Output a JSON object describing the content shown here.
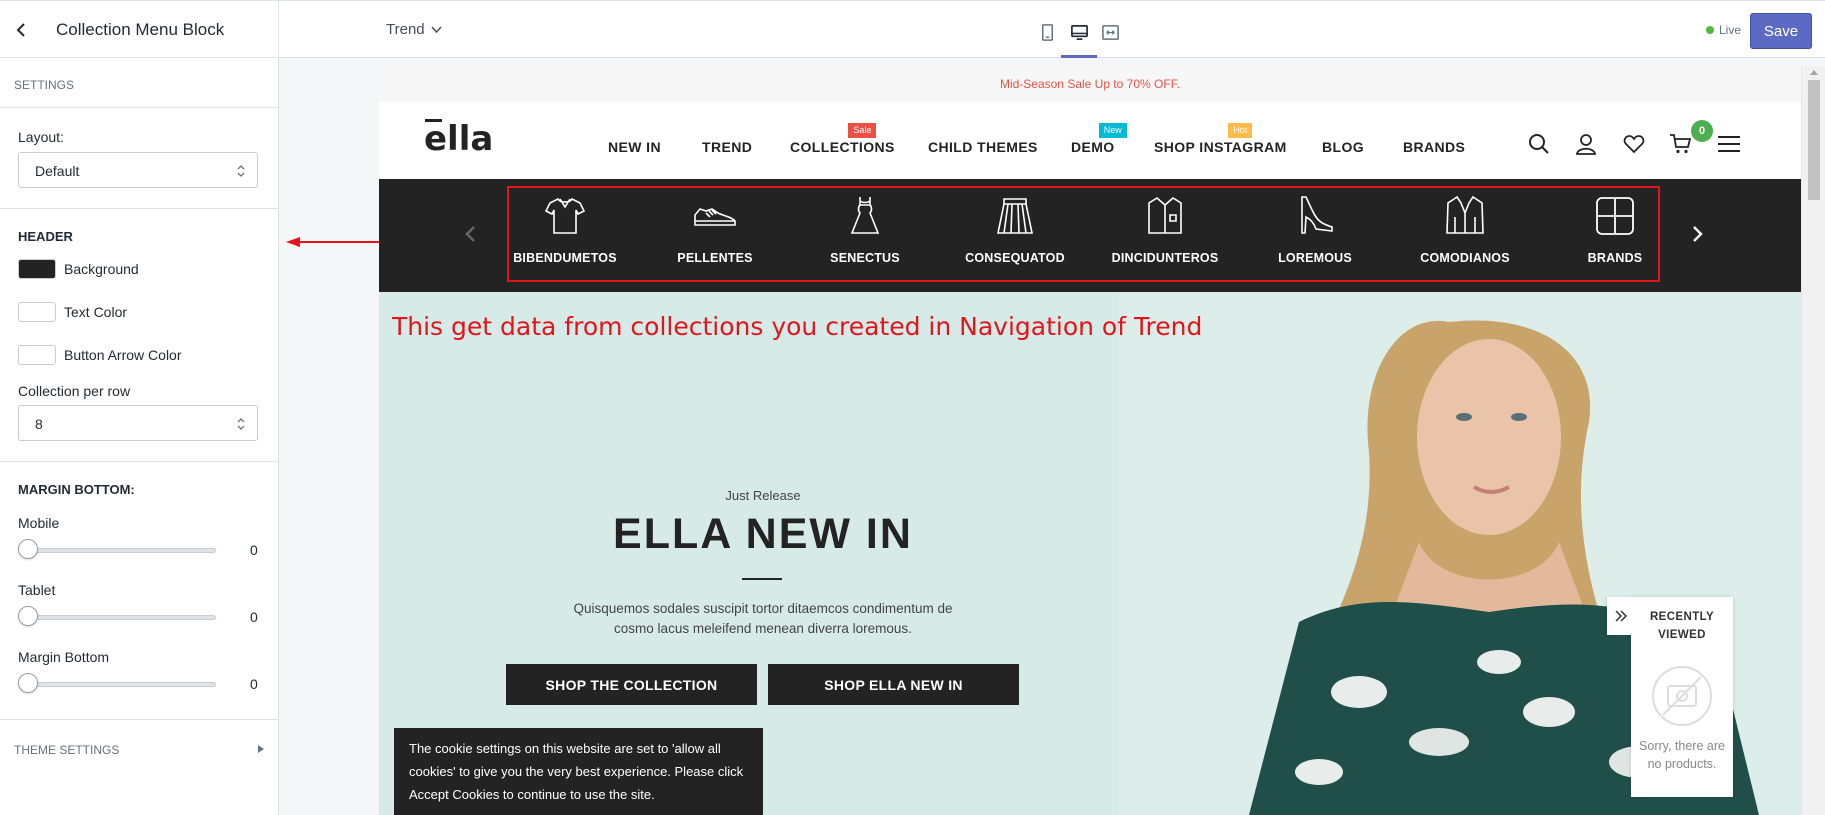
{
  "topbar": {
    "title": "Collection Menu Block",
    "theme_name": "Trend",
    "live_label": "Live",
    "save_label": "Save"
  },
  "sidebar": {
    "settings_heading": "SETTINGS",
    "layout_label": "Layout:",
    "layout_value": "Default",
    "header_heading": "HEADER",
    "background_label": "Background",
    "background_color": "#232323",
    "text_color_label": "Text Color",
    "text_color": "#ffffff",
    "arrow_color_label": "Button Arrow Color",
    "arrow_color": "#ffffff",
    "per_row_label": "Collection per row",
    "per_row_value": "8",
    "margin_heading": "MARGIN BOTTOM:",
    "mobile_label": "Mobile",
    "mobile_value": "0",
    "tablet_label": "Tablet",
    "tablet_value": "0",
    "margin_bottom_label": "Margin Bottom",
    "margin_bottom_value": "0",
    "theme_settings_label": "THEME SETTINGS"
  },
  "preview": {
    "announcement": "Mid-Season Sale Up to 70% OFF.",
    "logo_text": "ella",
    "menu": [
      {
        "label": "NEW IN",
        "badge": "",
        "badge_color": ""
      },
      {
        "label": "TREND",
        "badge": "",
        "badge_color": ""
      },
      {
        "label": "COLLECTIONS",
        "badge": "Sale",
        "badge_color": "#e95144"
      },
      {
        "label": "CHILD THEMES",
        "badge": "",
        "badge_color": ""
      },
      {
        "label": "DEMO",
        "badge": "New",
        "badge_color": "#01bad4"
      },
      {
        "label": "SHOP INSTAGRAM",
        "badge": "Hot",
        "badge_color": "#ffbb49"
      },
      {
        "label": "BLOG",
        "badge": "",
        "badge_color": ""
      },
      {
        "label": "BRANDS",
        "badge": "",
        "badge_color": ""
      }
    ],
    "cart_count": "0",
    "collections": [
      {
        "label": "BIBENDUMETOS",
        "icon": "tshirt-icon"
      },
      {
        "label": "PELLENTES",
        "icon": "sneaker-icon"
      },
      {
        "label": "SENECTUS",
        "icon": "dress-icon"
      },
      {
        "label": "CONSEQUATOD",
        "icon": "skirt-icon"
      },
      {
        "label": "DINCIDUNTEROS",
        "icon": "shirt-icon"
      },
      {
        "label": "LOREMOUS",
        "icon": "high-heel-icon"
      },
      {
        "label": "COMODIANOS",
        "icon": "jacket-icon"
      },
      {
        "label": "BRANDS",
        "icon": "grid-icon"
      }
    ],
    "annotation_note": "This get data from collections you created in Navigation of Trend",
    "hero": {
      "eyebrow": "Just Release",
      "title": "ELLA NEW IN",
      "description": "Quisquemos sodales suscipit tortor ditaemcos condimentum de cosmo lacus meleifend menean diverra loremous.",
      "button_1": "SHOP THE COLLECTION",
      "button_2": "SHOP ELLA NEW IN"
    },
    "cookie_text": "The cookie settings on this website are set to 'allow all cookies' to give you the very best experience. Please click Accept Cookies to continue to use the site.",
    "recently_viewed": {
      "title": "RECENTLY VIEWED",
      "empty_text": "Sorry, there are no products."
    }
  }
}
